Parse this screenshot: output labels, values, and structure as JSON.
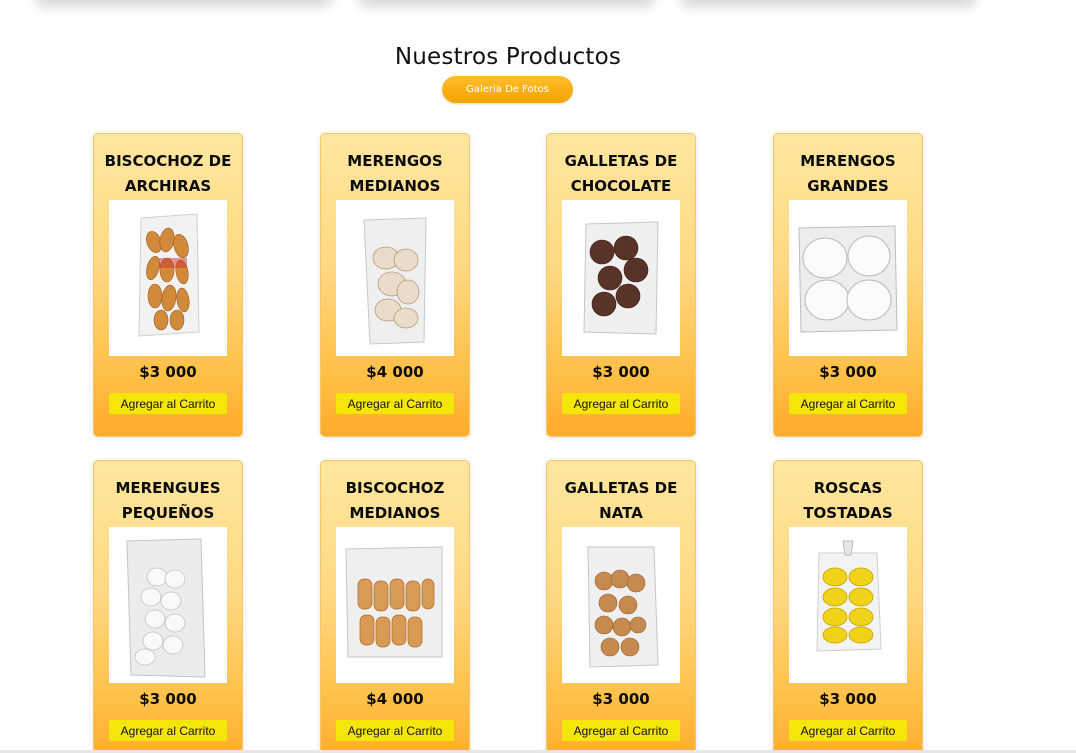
{
  "section": {
    "title": "Nuestros Productos",
    "gallery_button": "Galeria De Fotos"
  },
  "products": [
    {
      "name": "BISCOCHOZ DE ARCHIRAS",
      "price": "$3 000",
      "button": "Agregar al Carrito",
      "image": "package-breadsticks"
    },
    {
      "name": "MERENGOS MEDIANOS",
      "price": "$4 000",
      "button": "Agregar al Carrito",
      "image": "package-meringues"
    },
    {
      "name": "GALLETAS DE CHOCOLATE",
      "price": "$3 000",
      "button": "Agregar al Carrito",
      "image": "package-chocolate-cookies"
    },
    {
      "name": "MERENGOS GRANDES",
      "price": "$3 000",
      "button": "Agregar al Carrito",
      "image": "package-large-meringues"
    },
    {
      "name": "MERENGUES PEQUEÑOS",
      "price": "$3 000",
      "button": "Agregar al Carrito",
      "image": "package-small-meringues"
    },
    {
      "name": "BISCOCHOZ MEDIANOS",
      "price": "$4 000",
      "button": "Agregar al Carrito",
      "image": "package-biscuits"
    },
    {
      "name": "GALLETAS DE NATA",
      "price": "$3 000",
      "button": "Agregar al Carrito",
      "image": "package-cream-cookies"
    },
    {
      "name": "ROSCAS TOSTADAS",
      "price": "$3 000",
      "button": "Agregar al Carrito",
      "image": "package-toasted-rings"
    }
  ],
  "colors": {
    "card_top": "#ffe79f",
    "card_bottom": "#ffab2b",
    "button": "#f5e60a",
    "accent": "#f5a300"
  }
}
